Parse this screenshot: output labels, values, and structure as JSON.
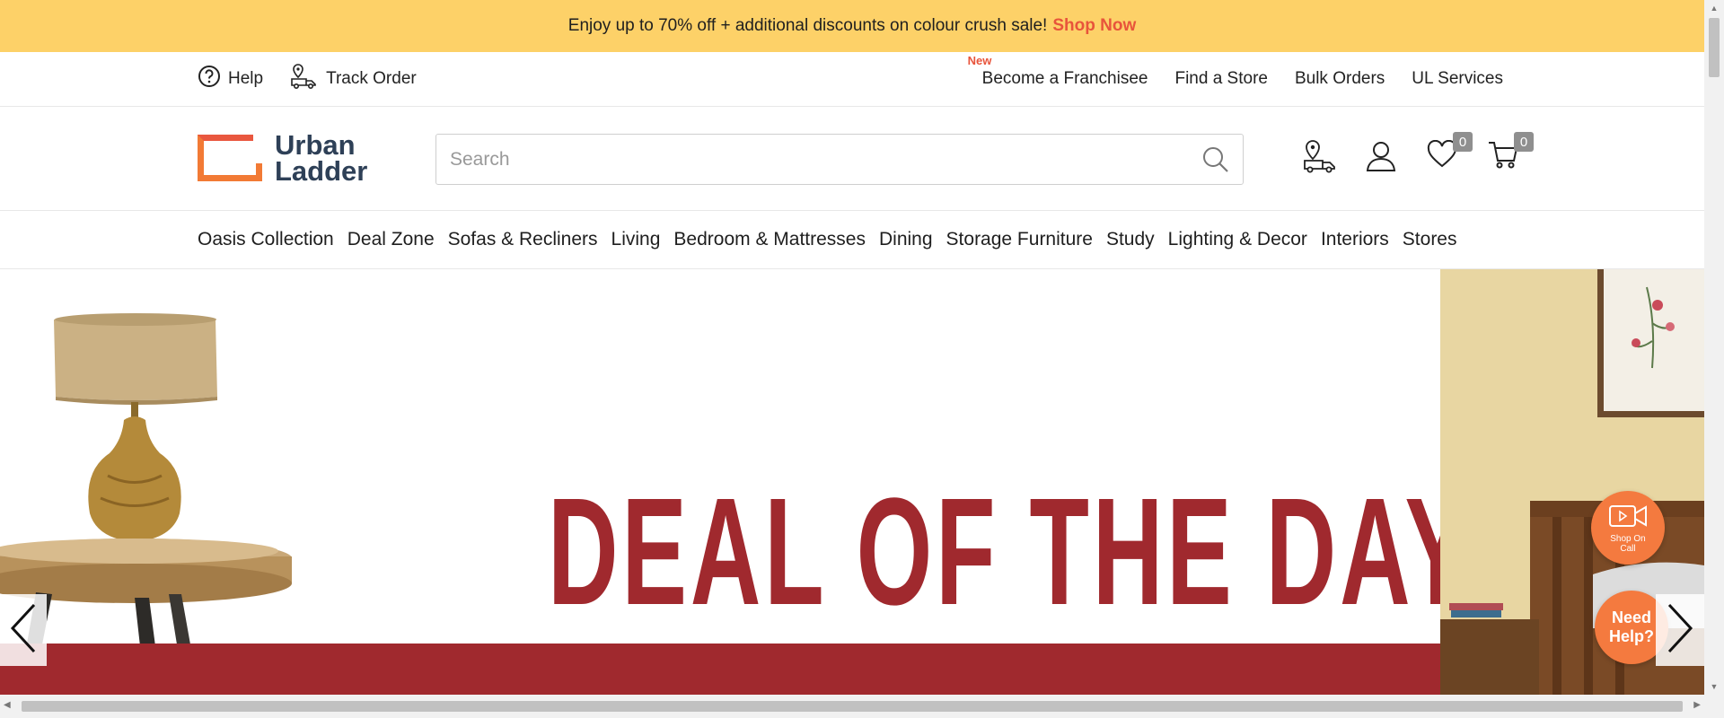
{
  "promo": {
    "text": "Enjoy up to 70% off + additional discounts on colour crush sale!",
    "link": "Shop Now"
  },
  "utility": {
    "help": "Help",
    "track_order": "Track Order",
    "new_tag": "New",
    "franchise": "Become a Franchisee",
    "find_store": "Find a Store",
    "bulk_orders": "Bulk Orders",
    "ul_services": "UL Services"
  },
  "logo": {
    "line1": "Urban",
    "line2": "Ladder"
  },
  "search": {
    "placeholder": "Search",
    "value": ""
  },
  "header_icons": {
    "wishlist_count": "0",
    "cart_count": "0"
  },
  "nav": {
    "items": [
      "Oasis Collection",
      "Deal Zone",
      "Sofas & Recliners",
      "Living",
      "Bedroom & Mattresses",
      "Dining",
      "Storage Furniture",
      "Study",
      "Lighting & Decor",
      "Interiors",
      "Stores"
    ]
  },
  "hero": {
    "headline": "DEAL OF THE DAY"
  },
  "widgets": {
    "shop_on_call": "Shop On Call",
    "need_help_line1": "Need",
    "need_help_line2": "Help?"
  },
  "colors": {
    "promo_bg": "#fdd168",
    "accent": "#e8543b",
    "brand_navy": "#2e4057",
    "deal_red": "#a0292e",
    "widget_orange": "#f47a3f"
  }
}
